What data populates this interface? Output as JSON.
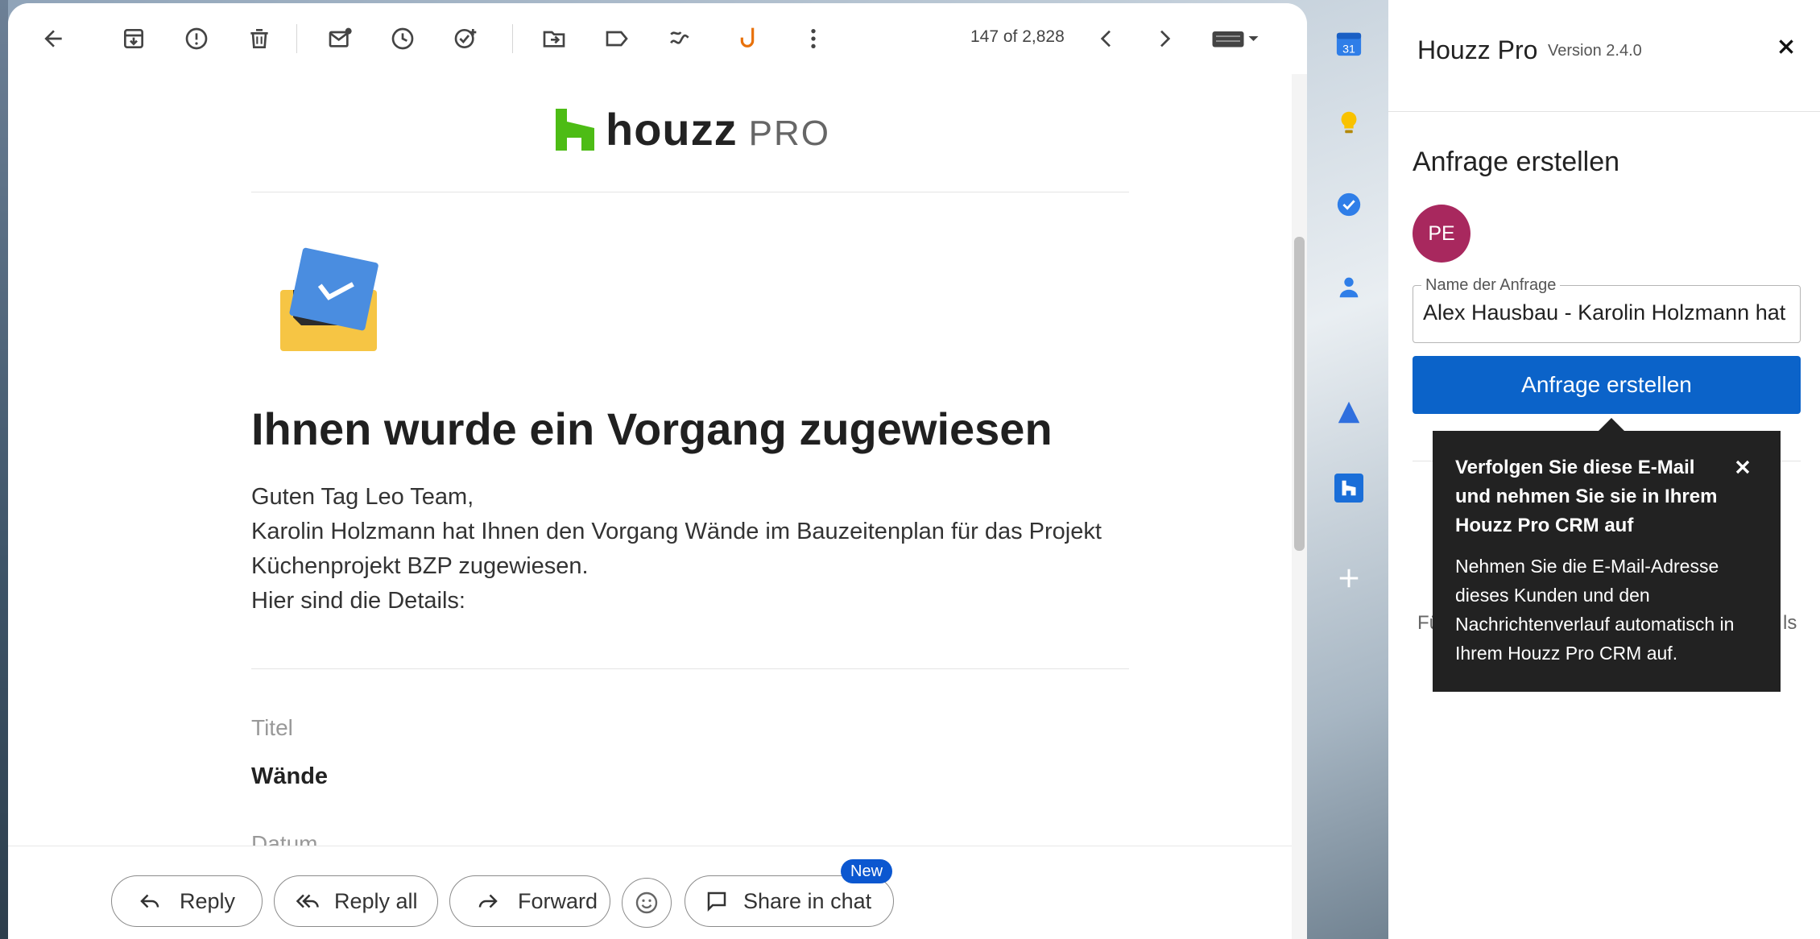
{
  "toolbar": {
    "counter": "147 of 2,828"
  },
  "email": {
    "logo_text": "houzz",
    "logo_pro": "PRO",
    "heading": "Ihnen wurde ein Vorgang zugewiesen",
    "body_lines": [
      "Guten Tag Leo Team,",
      "Karolin Holzmann hat Ihnen den Vorgang Wände im Bauzeitenplan für das Projekt",
      "Küchenprojekt BZP zugewiesen.",
      "Hier sind die Details:"
    ],
    "label_titel": "Titel",
    "value_titel": "Wände",
    "label_datum": "Datum"
  },
  "actions": {
    "reply": "Reply",
    "reply_all": "Reply all",
    "forward": "Forward",
    "share_in_chat": "Share in chat",
    "new_badge": "New"
  },
  "sidebar": {
    "calendar_day": "31"
  },
  "panel": {
    "title": "Houzz Pro",
    "version": "Version 2.4.0",
    "subtitle": "Anfrage erstellen",
    "avatar_initials": "PE",
    "field_label": "Name der Anfrage",
    "field_value": "Alex Hausbau - Karolin Holzmann hat Ihnen einen Vorgang zugewiesen",
    "create_button": "Anfrage erstellen",
    "hidden_left": "Fü",
    "hidden_right": "ls"
  },
  "tooltip": {
    "title": "Verfolgen Sie diese E-Mail und nehmen Sie sie in Ihrem Houzz Pro CRM auf",
    "body": "Nehmen Sie die E-Mail-Adresse dieses Kunden und den Nachrichtenverlauf automatisch in Ihrem Houzz Pro CRM auf."
  },
  "colors": {
    "houzz_green": "#4dbc15",
    "primary_blue": "#0b63c9",
    "avatar": "#a8285e",
    "tooltip_bg": "#222222",
    "snooze_orange": "#e8710a"
  }
}
